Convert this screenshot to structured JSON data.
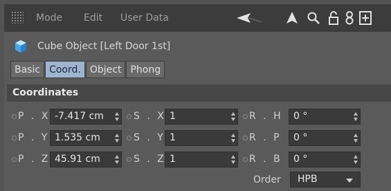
{
  "menubar": {
    "items": [
      "Mode",
      "Edit",
      "User Data"
    ]
  },
  "icons": {
    "back": "arrow-left-icon",
    "up": "arrow-up-icon",
    "search": "search-icon",
    "lock": "lock-icon",
    "link": "link-icon",
    "new": "add-panel-icon"
  },
  "object": {
    "title": "Cube Object [Left Door 1st]"
  },
  "tabs": [
    "Basic",
    "Coord.",
    "Object",
    "Phong"
  ],
  "active_tab": "Coord.",
  "section": {
    "title": "Coordinates"
  },
  "rows": [
    {
      "p_label": "P . X",
      "p_value": "-7.417 cm",
      "s_label": "S . X",
      "s_value": "1",
      "r_label": "R . H",
      "r_value": "0 °"
    },
    {
      "p_label": "P . Y",
      "p_value": "1.535 cm",
      "s_label": "S . Y",
      "s_value": "1",
      "r_label": "R . P",
      "r_value": "0 °"
    },
    {
      "p_label": "P . Z",
      "p_value": "45.91 cm",
      "s_label": "S . Z",
      "s_value": "1",
      "r_label": "R . B",
      "r_value": "0 °"
    }
  ],
  "order": {
    "label": "Order",
    "value": "HPB"
  },
  "colors": {
    "active_tab": "#9fb4d0",
    "panel": "#5a5a5a",
    "menubar": "#3c3c3c",
    "field": "#3a3a3a"
  }
}
